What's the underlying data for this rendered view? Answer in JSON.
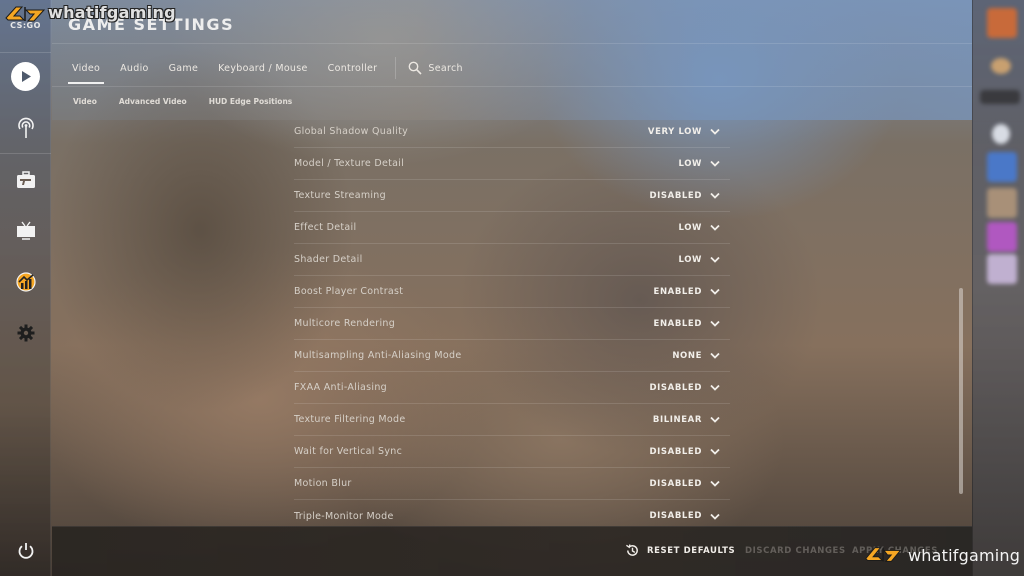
{
  "app": {
    "logo_text": "CS:GO",
    "watermark": "whatifgaming",
    "brand_color": "#f5a623"
  },
  "header": {
    "title": "GAME SETTINGS"
  },
  "tabs": [
    {
      "label": "Video",
      "active": true
    },
    {
      "label": "Audio",
      "active": false
    },
    {
      "label": "Game",
      "active": false
    },
    {
      "label": "Keyboard / Mouse",
      "active": false
    },
    {
      "label": "Controller",
      "active": false
    }
  ],
  "search": {
    "label": "Search",
    "icon": "search-icon"
  },
  "subtabs": [
    {
      "label": "Video"
    },
    {
      "label": "Advanced Video"
    },
    {
      "label": "HUD Edge Positions"
    }
  ],
  "left_nav": {
    "items": [
      {
        "icon": "play-icon",
        "label": "Play"
      },
      {
        "icon": "broadcast-icon",
        "label": "Watch"
      },
      {
        "icon": "inventory-icon",
        "label": "Inventory"
      },
      {
        "icon": "tv-icon",
        "label": "TV"
      },
      {
        "icon": "stats-icon",
        "label": "Stats"
      },
      {
        "icon": "gear-icon",
        "label": "Settings"
      }
    ],
    "power": {
      "icon": "power-icon"
    }
  },
  "settings": [
    {
      "label": "Global Shadow Quality",
      "value": "VERY LOW"
    },
    {
      "label": "Model / Texture Detail",
      "value": "LOW"
    },
    {
      "label": "Texture Streaming",
      "value": "DISABLED"
    },
    {
      "label": "Effect Detail",
      "value": "LOW"
    },
    {
      "label": "Shader Detail",
      "value": "LOW"
    },
    {
      "label": "Boost Player Contrast",
      "value": "ENABLED"
    },
    {
      "label": "Multicore Rendering",
      "value": "ENABLED"
    },
    {
      "label": "Multisampling Anti-Aliasing Mode",
      "value": "NONE"
    },
    {
      "label": "FXAA Anti-Aliasing",
      "value": "DISABLED"
    },
    {
      "label": "Texture Filtering Mode",
      "value": "BILINEAR"
    },
    {
      "label": "Wait for Vertical Sync",
      "value": "DISABLED"
    },
    {
      "label": "Motion Blur",
      "value": "DISABLED"
    },
    {
      "label": "Triple-Monitor Mode",
      "value": "DISABLED"
    }
  ],
  "footer": {
    "reset_label": "RESET DEFAULTS",
    "discard_label": "DISCARD CHANGES",
    "apply_label": "APPLY CHANGES"
  },
  "right_panel": {
    "avatars": [
      "#c86a3a",
      "#c8a070",
      "#3a3a3e",
      "#d8dce4",
      "#4a78c8",
      "#a89078",
      "#b058c0",
      "#c0b0d0"
    ]
  }
}
